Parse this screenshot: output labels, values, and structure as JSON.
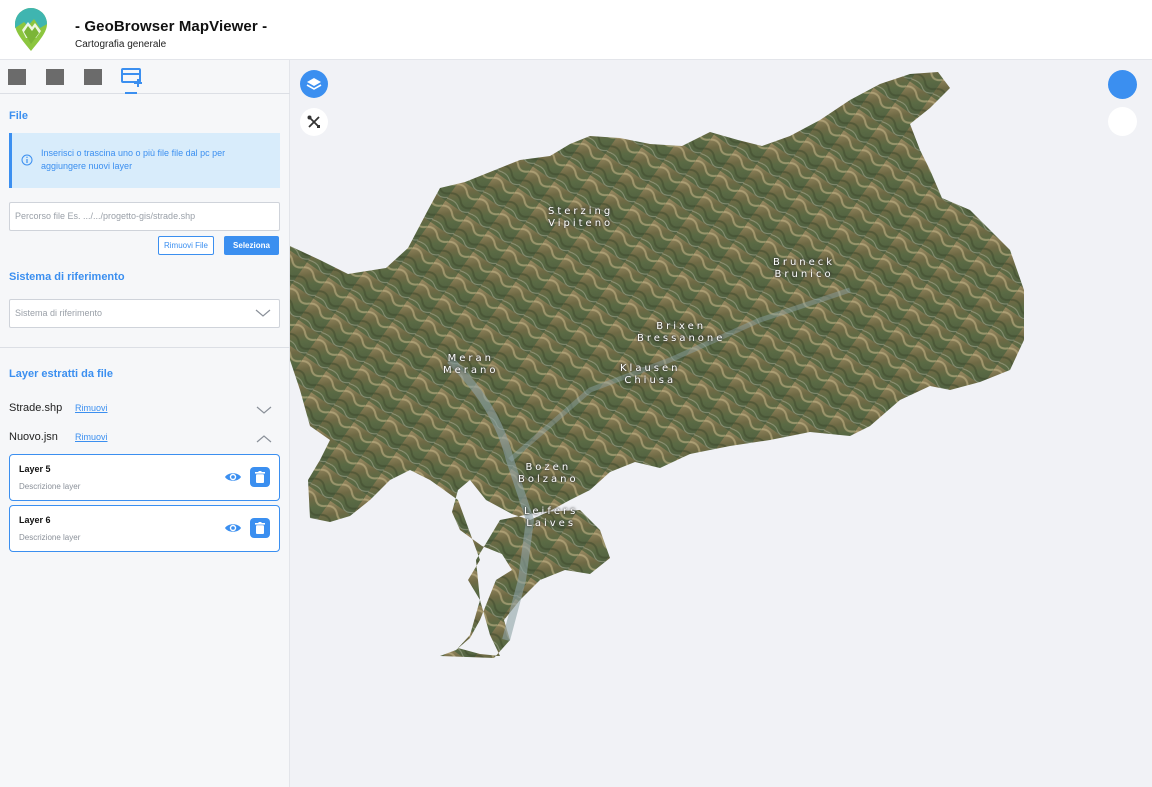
{
  "header": {
    "title": "- GeoBrowser MapViewer -",
    "subtitle": "Cartografia generale"
  },
  "colors": {
    "accent": "#3b8ff0",
    "info_bg": "#d8ecfb",
    "sidebar_bg": "#f6f7f9",
    "map_bg": "#f1f2f6"
  },
  "tabs": [
    {
      "icon": "square-tab-icon",
      "active": false
    },
    {
      "icon": "square-tab-icon",
      "active": false
    },
    {
      "icon": "square-tab-icon",
      "active": false
    },
    {
      "icon": "add-layer-icon",
      "active": true
    }
  ],
  "file_section": {
    "title": "File",
    "info_text": "Inserisci o trascina uno o più file  file dal pc per aggiungere nuovi layer",
    "path_placeholder": "Percorso file Es. .../.../progetto-gis/strade.shp",
    "remove_files_label": "Rimuovi File",
    "select_label": "Seleziona"
  },
  "crs_section": {
    "title": "Sistema di riferimento",
    "select_placeholder": "Sistema di riferimento"
  },
  "layers_section": {
    "title": "Layer estratti da file",
    "files": [
      {
        "name": "Strade.shp",
        "remove_label": "Rimuovi",
        "expanded": false
      },
      {
        "name": "Nuovo.jsn",
        "remove_label": "Rimuovi",
        "expanded": true
      }
    ],
    "layers": [
      {
        "title": "Layer 5",
        "description": "Descrizione layer"
      },
      {
        "title": "Layer 6",
        "description": "Descrizione layer"
      }
    ]
  },
  "map": {
    "places": [
      {
        "line1": "Sterzing",
        "line2": "Vipiteno"
      },
      {
        "line1": "Bruneck",
        "line2": "Brunico"
      },
      {
        "line1": "Brixen",
        "line2": "Bressanone"
      },
      {
        "line1": "Meran",
        "line2": "Merano"
      },
      {
        "line1": "Klausen",
        "line2": "Chiusa"
      },
      {
        "line1": "Bozen",
        "line2": "Bolzano"
      },
      {
        "line1": "Leifers",
        "line2": "Laives"
      }
    ]
  }
}
